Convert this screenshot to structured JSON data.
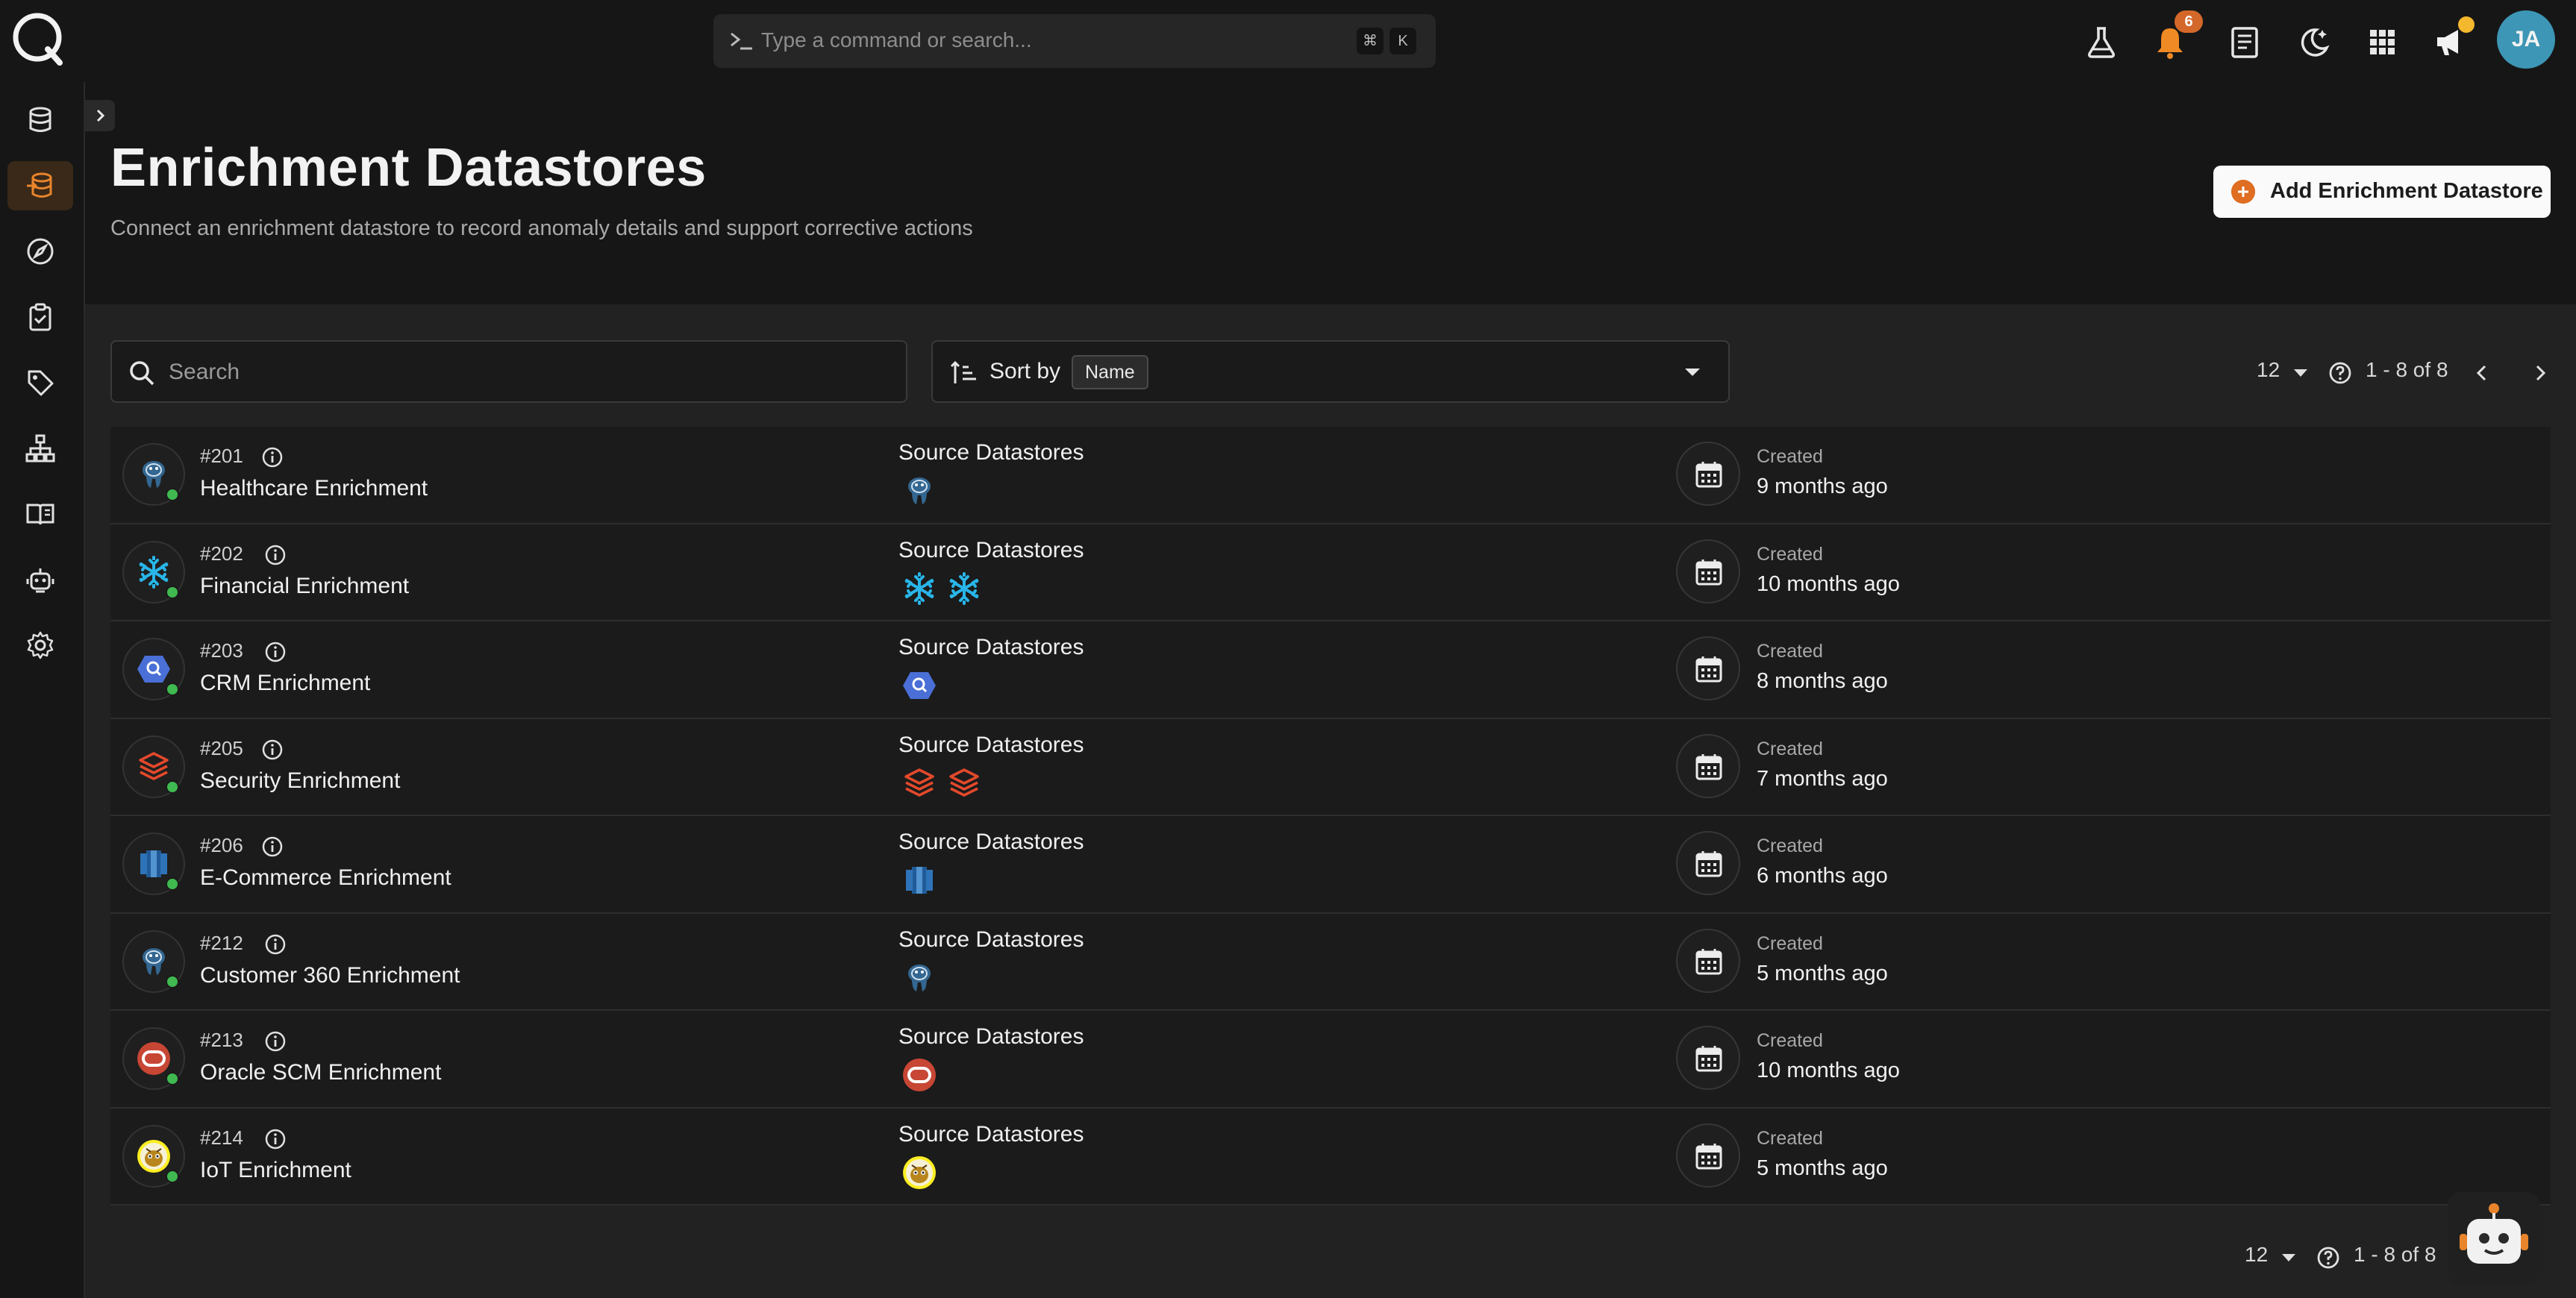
{
  "topbar": {
    "command_placeholder": "Type a command or search...",
    "shortcut_keys": [
      "⌘",
      "K"
    ],
    "notification_count": "6",
    "user_initials": "JA",
    "icons": [
      "flask-icon",
      "bell-icon",
      "document-icon",
      "moon-icon",
      "apps-grid-icon",
      "megaphone-icon"
    ]
  },
  "sidebar": {
    "items": [
      {
        "icon": "database-icon"
      },
      {
        "icon": "enrichment-datastore-icon",
        "active": true
      },
      {
        "icon": "compass-icon"
      },
      {
        "icon": "clipboard-check-icon"
      },
      {
        "icon": "tag-icon"
      },
      {
        "icon": "hierarchy-icon"
      },
      {
        "icon": "book-icon"
      },
      {
        "icon": "robot-icon"
      },
      {
        "icon": "gear-icon"
      }
    ]
  },
  "header": {
    "title": "Enrichment Datastores",
    "subtitle": "Connect an enrichment datastore to record anomaly details and support corrective actions",
    "add_button": "Add Enrichment Datastore"
  },
  "toolbar": {
    "search_placeholder": "Search",
    "sort_label": "Sort by",
    "sort_value": "Name"
  },
  "pagination": {
    "page_size": "12",
    "range": "1 - 8 of 8"
  },
  "columns": {
    "source": "Source Datastores",
    "created": "Created"
  },
  "rows": [
    {
      "id": "#201",
      "name": "Healthcare Enrichment",
      "type": "postgres",
      "sources": [
        "postgres"
      ],
      "created": "9 months ago"
    },
    {
      "id": "#202",
      "name": "Financial Enrichment",
      "type": "snowflake",
      "sources": [
        "snowflake",
        "snowflake"
      ],
      "created": "10 months ago"
    },
    {
      "id": "#203",
      "name": "CRM Enrichment",
      "type": "bigquery",
      "sources": [
        "bigquery"
      ],
      "created": "8 months ago"
    },
    {
      "id": "#205",
      "name": "Security Enrichment",
      "type": "databricks",
      "sources": [
        "databricks",
        "databricks"
      ],
      "created": "7 months ago"
    },
    {
      "id": "#206",
      "name": "E-Commerce Enrichment",
      "type": "redshift",
      "sources": [
        "redshift"
      ],
      "created": "6 months ago"
    },
    {
      "id": "#212",
      "name": "Customer 360 Enrichment",
      "type": "postgres",
      "sources": [
        "postgres"
      ],
      "created": "5 months ago"
    },
    {
      "id": "#213",
      "name": "Oracle SCM Enrichment",
      "type": "oracle",
      "sources": [
        "oracle"
      ],
      "created": "10 months ago"
    },
    {
      "id": "#214",
      "name": "IoT Enrichment",
      "type": "hive",
      "sources": [
        "hive"
      ],
      "created": "5 months ago"
    }
  ],
  "colors": {
    "accent": "#df6d22",
    "status_online": "#3fb950",
    "avatar": "#3d96b5"
  }
}
